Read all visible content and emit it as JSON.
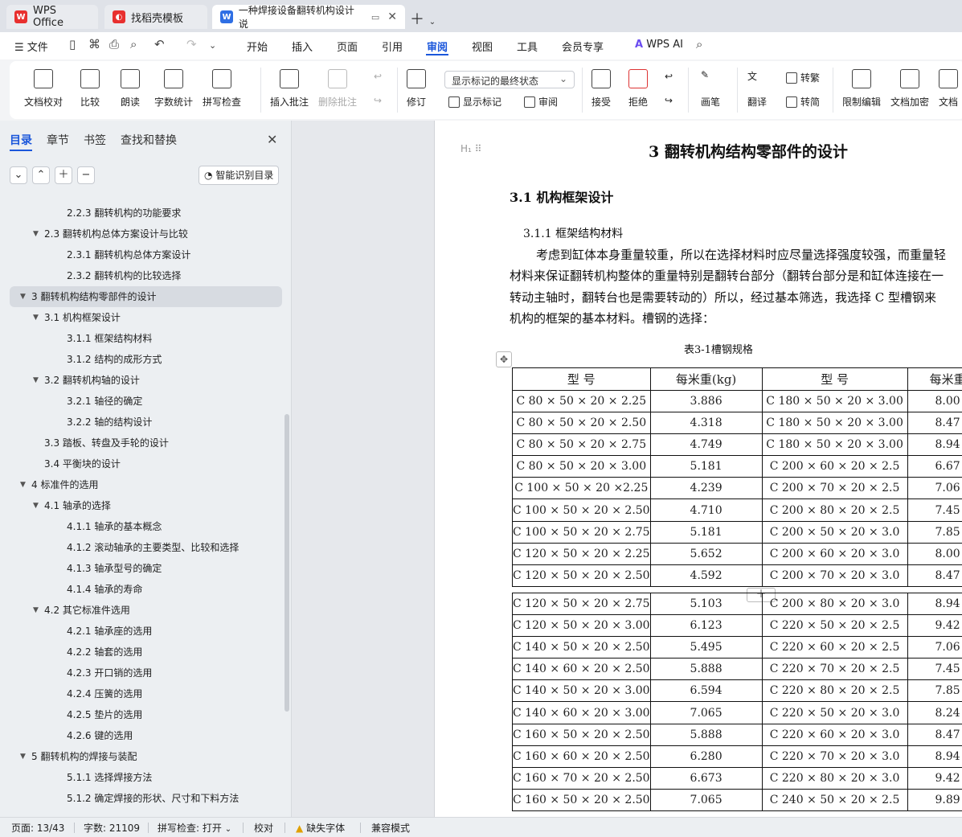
{
  "tabs": [
    {
      "label": "WPS Office"
    },
    {
      "label": "找稻壳模板"
    },
    {
      "label": "一种焊接设备翻转机构设计 说"
    }
  ],
  "menu": {
    "file": "文件",
    "items": [
      "开始",
      "插入",
      "页面",
      "引用",
      "审阅",
      "视图",
      "工具",
      "会员专享"
    ],
    "active": "审阅",
    "ai": "WPS AI"
  },
  "ribbon": {
    "doc_check": "文档校对",
    "compare": "比较",
    "read_aloud": "朗读",
    "word_count": "字数统计",
    "spell_check": "拼写检查",
    "insert_comment": "插入批注",
    "delete_comment": "删除批注",
    "revise": "修订",
    "markup_state": "显示标记的最终状态",
    "show_markup": "显示标记",
    "review": "审阅",
    "accept": "接受",
    "reject": "拒绝",
    "brush": "画笔",
    "translate": "翻译",
    "to_traditional": "转繁",
    "to_simplified": "转简",
    "restrict_edit": "限制编辑",
    "encrypt": "文档加密",
    "doc_more": "文档"
  },
  "nav": {
    "tabs": [
      "目录",
      "章节",
      "书签",
      "查找和替换"
    ],
    "smart_toc": "智能识别目录",
    "toc": [
      {
        "text": "2.2.3  翻转机构的功能要求",
        "level": 3
      },
      {
        "text": "2.3  翻转机构总体方案设计与比较",
        "level": 2,
        "caret": true
      },
      {
        "text": "2.3.1  翻转机构总体方案设计",
        "level": 3
      },
      {
        "text": "2.3.2  翻转机构的比较选择",
        "level": 3
      },
      {
        "text": "3  翻转机构结构零部件的设计",
        "level": 1,
        "caret": true,
        "selected": true
      },
      {
        "text": "3.1  机构框架设计",
        "level": 2,
        "caret": true
      },
      {
        "text": "3.1.1  框架结构材料",
        "level": 3
      },
      {
        "text": "3.1.2  结构的成形方式",
        "level": 3
      },
      {
        "text": "3.2  翻转机构轴的设计",
        "level": 2,
        "caret": true
      },
      {
        "text": "3.2.1  轴径的确定",
        "level": 3
      },
      {
        "text": "3.2.2  轴的结构设计",
        "level": 3
      },
      {
        "text": "3.3  踏板、转盘及手轮的设计",
        "level": 2
      },
      {
        "text": "3.4  平衡块的设计",
        "level": 2
      },
      {
        "text": "4  标准件的选用",
        "level": 1,
        "caret": true
      },
      {
        "text": "4.1  轴承的选择",
        "level": 2,
        "caret": true
      },
      {
        "text": "4.1.1  轴承的基本概念",
        "level": 3
      },
      {
        "text": "4.1.2  滚动轴承的主要类型、比较和选择",
        "level": 3
      },
      {
        "text": "4.1.3  轴承型号的确定",
        "level": 3
      },
      {
        "text": "4.1.4  轴承的寿命",
        "level": 3
      },
      {
        "text": "4.2  其它标准件选用",
        "level": 2,
        "caret": true
      },
      {
        "text": "4.2.1  轴承座的选用",
        "level": 3
      },
      {
        "text": "4.2.2  轴套的选用",
        "level": 3
      },
      {
        "text": "4.2.3  开口销的选用",
        "level": 3
      },
      {
        "text": "4.2.4  压簧的选用",
        "level": 3
      },
      {
        "text": "4.2.5  垫片的选用",
        "level": 3
      },
      {
        "text": "4.2.6  键的选用",
        "level": 3
      },
      {
        "text": "5  翻转机构的焊接与装配",
        "level": 1,
        "caret": true
      },
      {
        "text": "5.1.1  选择焊接方法",
        "level": 3
      },
      {
        "text": "5.1.2  确定焊接的形状、尺寸和下料方法",
        "level": 3
      }
    ]
  },
  "doc": {
    "heading_marker": "H₁",
    "chapter_title": "3  翻转机构结构零部件的设计",
    "section_title": "3.1  机构框架设计",
    "subsection_title": "3.1.1  框架结构材料",
    "paragraph_lines": [
      "考虑到缸体本身重量较重，所以在选择材料时应尽量选择强度较强，而重量轻",
      "材料来保证翻转机构整体的重量特别是翻转台部分（翻转台部分是和缸体连接在一",
      "转动主轴时，翻转台也是需要转动的）所以，经过基本筛选，我选择 C 型槽钢来",
      "机构的框架的基本材料。槽钢的选择："
    ],
    "table_caption": "表3-1槽钢规格",
    "table_headers": [
      "型  号",
      "每米重(kg)",
      "型  号",
      "每米重"
    ],
    "table_rows_a": [
      [
        "C 80 × 50 × 20 × 2.25",
        "3.886",
        "C 180 × 50 × 20 × 3.00",
        "8.00"
      ],
      [
        "C 80 × 50 × 20 × 2.50",
        "4.318",
        "C 180 × 50 × 20 × 3.00",
        "8.47"
      ],
      [
        "C 80 × 50 × 20 × 2.75",
        "4.749",
        "C 180 × 50 × 20 × 3.00",
        "8.94"
      ],
      [
        "C 80 × 50 × 20 × 3.00",
        "5.181",
        "C 200 × 60 × 20 × 2.5",
        "6.67"
      ],
      [
        "C 100 × 50 × 20 ×2.25",
        "4.239",
        "C 200 × 70 × 20 × 2.5",
        "7.06"
      ],
      [
        "C 100 × 50 × 20 × 2.50",
        "4.710",
        "C 200 × 80 × 20 × 2.5",
        "7.45"
      ],
      [
        "C 100 × 50 × 20 × 2.75",
        "5.181",
        "C 200 × 50 × 20 × 3.0",
        "7.85"
      ],
      [
        "C 120 × 50 × 20 × 2.25",
        "5.652",
        "C 200 × 60 × 20 × 3.0",
        "8.00"
      ],
      [
        "C 120 × 50 × 20 × 2.50",
        "4.592",
        "C 200 × 70 × 20 × 3.0",
        "8.47"
      ]
    ],
    "table_rows_b": [
      [
        "C 120 × 50 × 20 × 2.75",
        "5.103",
        "C 200 × 80 × 20 × 3.0",
        "8.94"
      ],
      [
        "C 120 × 50 × 20 × 3.00",
        "6.123",
        "C 220 × 50 × 20 × 2.5",
        "9.42"
      ],
      [
        "C 140 × 50 × 20 × 2.50",
        "5.495",
        "C 220 × 60 × 20 × 2.5",
        "7.06"
      ],
      [
        "C 140 × 60 × 20 × 2.50",
        "5.888",
        "C 220 × 70 × 20 × 2.5",
        "7.45"
      ],
      [
        "C 140 × 50 × 20 × 3.00",
        "6.594",
        "C 220 × 80 × 20 × 2.5",
        "7.85"
      ],
      [
        "C 140 × 60 × 20 × 3.00",
        "7.065",
        "C 220 × 50 × 20 × 3.0",
        "8.24"
      ],
      [
        "C 160 × 50 × 20 × 2.50",
        "5.888",
        "C 220 × 60 × 20 × 3.0",
        "8.47"
      ],
      [
        "C 160 × 60 × 20 × 2.50",
        "6.280",
        "C 220 × 70 × 20 × 3.0",
        "8.94"
      ],
      [
        "C 160 × 70 × 20 × 2.50",
        "6.673",
        "C 220 × 80 × 20 × 3.0",
        "9.42"
      ],
      [
        "C 160 × 50 × 20 × 2.50",
        "7.065",
        "C 240 × 50 × 20 × 2.5",
        "9.89"
      ]
    ]
  },
  "status": {
    "page": "页面: 13/43",
    "words": "字数: 21109",
    "spell": "拼写检查: 打开",
    "proofread": "校对",
    "missing_font": "缺失字体",
    "compat": "兼容模式"
  }
}
